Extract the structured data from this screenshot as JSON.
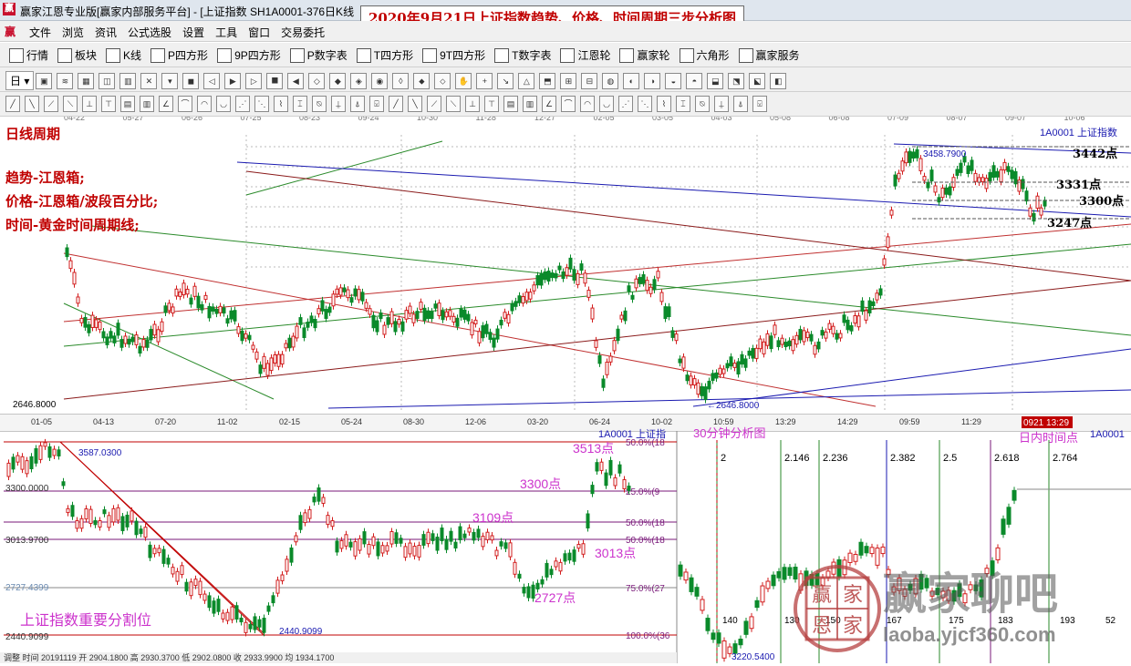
{
  "window": {
    "title": "赢家江恩专业版[赢家内部服务平台] - [上证指数  SH1A0001-376日K线",
    "banner": "2020年9月21日上证指数趋势、价格、时间周期三步分析图"
  },
  "menu": {
    "logo": "赢",
    "items": [
      "文件",
      "浏览",
      "资讯",
      "公式选股",
      "设置",
      "工具",
      "窗口",
      "交易委托"
    ]
  },
  "toolbar1": {
    "buttons": [
      {
        "icon": "bars",
        "label": "行情"
      },
      {
        "icon": "grid",
        "label": "板块"
      },
      {
        "icon": "kline",
        "label": "K线"
      },
      {
        "icon": "P",
        "label": "P四方形"
      },
      {
        "icon": "9P",
        "label": "9P四方形"
      },
      {
        "icon": "PN",
        "label": "P数字表"
      },
      {
        "icon": "TS",
        "label": "T四方形"
      },
      {
        "icon": "T9",
        "label": "9T四方形"
      },
      {
        "icon": "TN",
        "label": "T数字表"
      },
      {
        "icon": "wheel",
        "label": "江恩轮"
      },
      {
        "icon": "win-wheel",
        "label": "赢家轮"
      },
      {
        "icon": "hex",
        "label": "六角形"
      },
      {
        "icon": "dollar",
        "label": "赢家服务"
      }
    ]
  },
  "toolbar2": {
    "label": "日",
    "count": 36
  },
  "toolbar3": {
    "count": 40
  },
  "top_chart": {
    "top_dates": [
      "04-22",
      "05-27",
      "06-26",
      "07-25",
      "08-23",
      "09-24",
      "10-30",
      "11-28",
      "12-27",
      "02-05",
      "03-05",
      "04-03",
      "05-08",
      "06-08",
      "07-09",
      "08-07",
      "09-07",
      "10-06"
    ],
    "bottom_dates": [
      "01-05",
      "04-13",
      "07-20",
      "11-02",
      "02-15",
      "05-24",
      "08-30",
      "12-06",
      "03-20",
      "06-24",
      "10-02",
      "10:59",
      "13:29",
      "14:29",
      "09:59",
      "11:29",
      "13:29"
    ],
    "ticker_label": "1A0001  上证指数",
    "annotations": [
      "日线周期",
      "趋势-江恩箱;",
      "价格-江恩箱/波段百分比;",
      "时间-黄金时间周期线;"
    ],
    "levels": [
      "3442点",
      "3331点",
      "3300点",
      "3247点"
    ],
    "peak_value": "3458.7900",
    "low_value_left": "2646.8000",
    "low_value_bottom": "2646.8000",
    "date_badge": "0921 13:29"
  },
  "bottom_left": {
    "ticker_label": "1A0001  上证指",
    "high": "3587.0300",
    "left_levels": [
      "3300.0000",
      "3013.9700",
      "2727.4399",
      "2440.9099"
    ],
    "low": "2440.9099",
    "pct_levels": [
      "50.0%(18",
      "25.0%(9",
      "50.0%(18",
      "50.0%(18",
      "75.0%(27",
      "100.0%(36"
    ],
    "magenta_labels": [
      "3513点",
      "3300点",
      "3109点",
      "3013点",
      "2727点"
    ],
    "title": "上证指数重要分割位",
    "footer": "调整 时间 20191119 开 2904.1800 高 2930.3700 低 2902.0800 收 2933.9900 均 1934.1700"
  },
  "bottom_right": {
    "title": "30分钟分析图",
    "ticker_label": "1A0001",
    "intraday_label": "日内时间点",
    "fib_labels": [
      "2",
      "2.146",
      "2.236",
      "2.382",
      "2.5",
      "2.618",
      "2.764"
    ],
    "bottom_numbers": [
      "140",
      "130",
      "150",
      "167",
      "175",
      "183",
      "193",
      "52"
    ],
    "low_value": "3220.5400"
  },
  "watermark": {
    "seal_chars": [
      "赢",
      "家",
      "恩",
      "家"
    ],
    "name": "赢家聊吧",
    "url": "laoba.yjcf360.com"
  },
  "colors": {
    "red": "#c00000",
    "magenta": "#cc33cc",
    "green_line": "#2a8a2a",
    "blue_line": "#1a1ab0",
    "maroon_line": "#8a1a1a"
  }
}
